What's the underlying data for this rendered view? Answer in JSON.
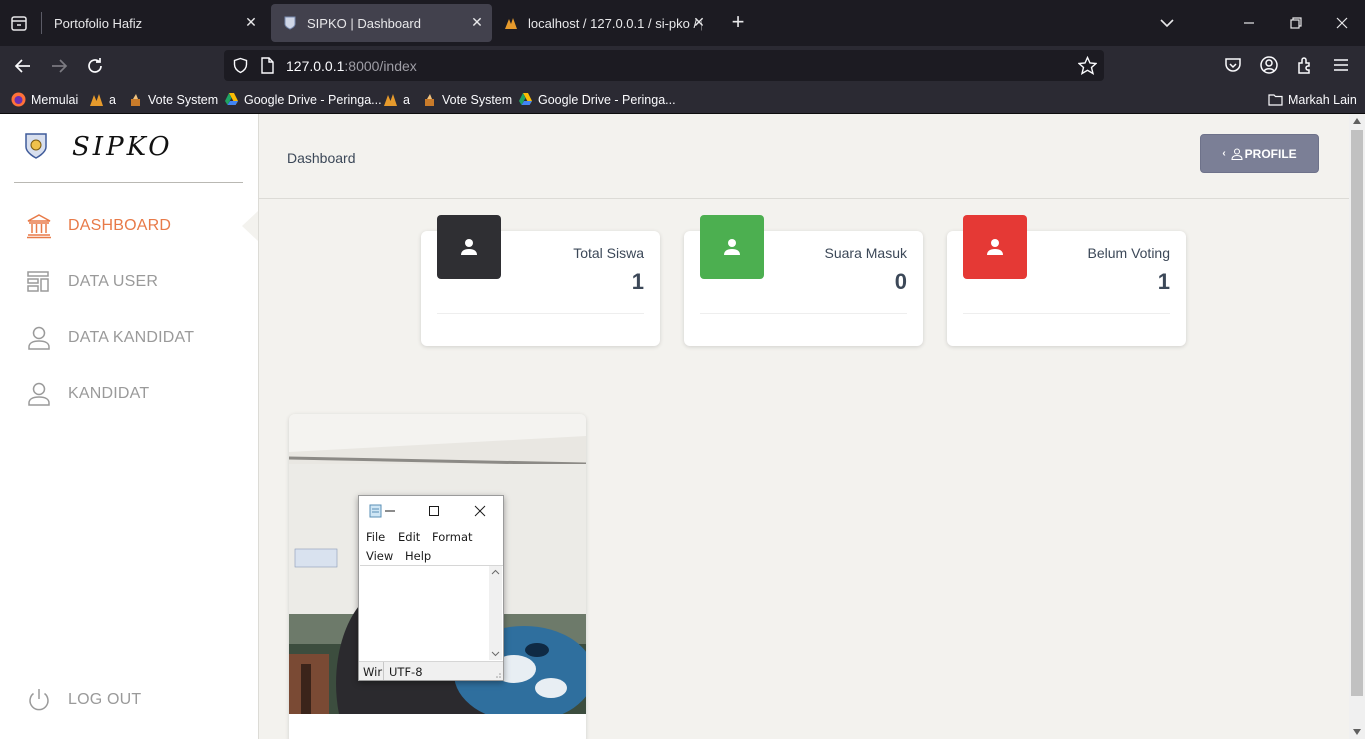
{
  "browser": {
    "tabs": [
      {
        "title": "Portofolio Hafiz",
        "active": false
      },
      {
        "title": "SIPKO | Dashboard",
        "active": true
      },
      {
        "title": "localhost / 127.0.0.1 / si-pko / p",
        "active": false
      }
    ],
    "url_host": "127.0.0.1",
    "url_rest": ":8000/index",
    "bookmarks": [
      {
        "label": "Memulai",
        "icon": "firefox-icon"
      },
      {
        "label": "a",
        "icon": "xampp-icon"
      },
      {
        "label": "Vote System",
        "icon": "vote-icon"
      },
      {
        "label": "Google Drive - Peringa...",
        "icon": "google-drive-icon"
      },
      {
        "label": "a",
        "icon": "xampp-icon"
      },
      {
        "label": "Vote System",
        "icon": "vote-icon"
      },
      {
        "label": "Google Drive - Peringa...",
        "icon": "google-drive-icon"
      }
    ],
    "other_bookmarks": "Markah Lain"
  },
  "sidebar": {
    "app_name": "SIPKO",
    "menu": [
      {
        "label": "DASHBOARD",
        "icon": "bank-icon",
        "active": true
      },
      {
        "label": "DATA USER",
        "icon": "list-icon",
        "active": false
      },
      {
        "label": "DATA KANDIDAT",
        "icon": "user-icon",
        "active": false
      },
      {
        "label": "KANDIDAT",
        "icon": "user-icon",
        "active": false
      }
    ],
    "logout": {
      "label": "LOG OUT",
      "icon": "power-icon"
    }
  },
  "header": {
    "breadcrumb": "Dashboard",
    "profile_button": "PROFILE"
  },
  "stats": [
    {
      "label": "Total Siswa",
      "value": "1",
      "color": "#2f2f33"
    },
    {
      "label": "Suara Masuk",
      "value": "0",
      "color": "#4caf50"
    },
    {
      "label": "Belum Voting",
      "value": "1",
      "color": "#e53935"
    }
  ],
  "notepad": {
    "menu": [
      "File",
      "Edit",
      "Format",
      "View",
      "Help"
    ],
    "status_left": "Wir",
    "encoding": "UTF-8"
  },
  "colors": {
    "accent": "#e87a48",
    "profile_button": "#7b7f96",
    "text": "#3c4858"
  }
}
